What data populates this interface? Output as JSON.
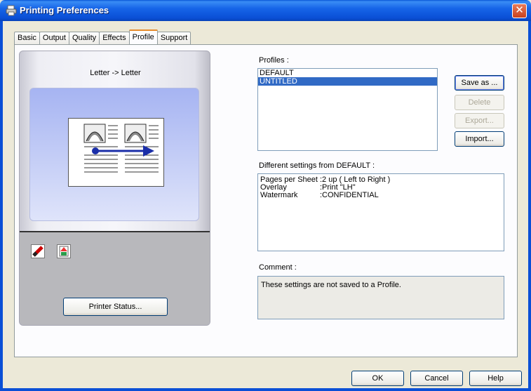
{
  "window": {
    "title": "Printing Preferences"
  },
  "tabs": [
    {
      "label": "Basic"
    },
    {
      "label": "Output"
    },
    {
      "label": "Quality"
    },
    {
      "label": "Effects"
    },
    {
      "label": "Profile",
      "active": true
    },
    {
      "label": "Support"
    }
  ],
  "preview": {
    "caption": "Letter -> Letter",
    "printer_status_label": "Printer Status...",
    "icons": [
      "eraser-icon",
      "document-color-icon"
    ]
  },
  "profiles": {
    "label": "Profiles :",
    "items": [
      {
        "name": "DEFAULT",
        "selected": false
      },
      {
        "name": "UNTITLED",
        "selected": true
      }
    ],
    "buttons": {
      "save_as": "Save as ...",
      "delete": "Delete",
      "export": "Export...",
      "import": "Import..."
    }
  },
  "differences": {
    "label": "Different settings from DEFAULT :",
    "rows": [
      {
        "key": "Pages per Sheet",
        "value": ":2 up ( Left to Right )"
      },
      {
        "key": "Overlay",
        "value": ":Print \"LH\""
      },
      {
        "key": "Watermark",
        "value": ":CONFIDENTIAL"
      }
    ]
  },
  "comment": {
    "label": "Comment :",
    "text": "These settings are not saved to a Profile."
  },
  "footer": {
    "ok": "OK",
    "cancel": "Cancel",
    "help": "Help"
  },
  "colors": {
    "titlebar": "#0a4fd6",
    "selection": "#316ac5",
    "active_tab_accent": "#e68b2c",
    "preview_blue": "#a6b4f2"
  }
}
